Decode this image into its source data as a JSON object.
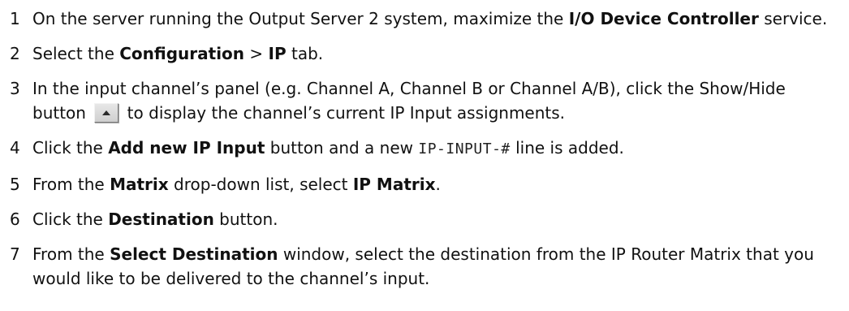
{
  "steps": [
    {
      "number": "1",
      "parts": [
        "On the server running the Output Server 2 system, maximize the ",
        "I/O Device Controller",
        " service."
      ]
    },
    {
      "number": "2",
      "parts": [
        "Select the ",
        "Configuration",
        " > ",
        "IP",
        " tab."
      ]
    },
    {
      "number": "3",
      "parts": [
        "In the input channel’s panel (e.g. Channel A, Channel B or Channel A/B), click the Show/Hide button ",
        " to display the channel’s current IP Input assignments."
      ],
      "icon": "show-hide-up-arrow-icon"
    },
    {
      "number": "4",
      "parts": [
        "Click the ",
        "Add new IP Input",
        " button and a new ",
        "IP-INPUT-#",
        " line is added."
      ]
    },
    {
      "number": "5",
      "parts": [
        "From the ",
        "Matrix",
        " drop-down list, select ",
        "IP Matrix",
        "."
      ]
    },
    {
      "number": "6",
      "parts": [
        "Click the ",
        "Destination",
        " button."
      ]
    },
    {
      "number": "7",
      "parts": [
        "From the ",
        "Select Destination",
        " window, select the destination from the IP Router Matrix that you would like to be delivered to the channel’s input."
      ]
    }
  ]
}
